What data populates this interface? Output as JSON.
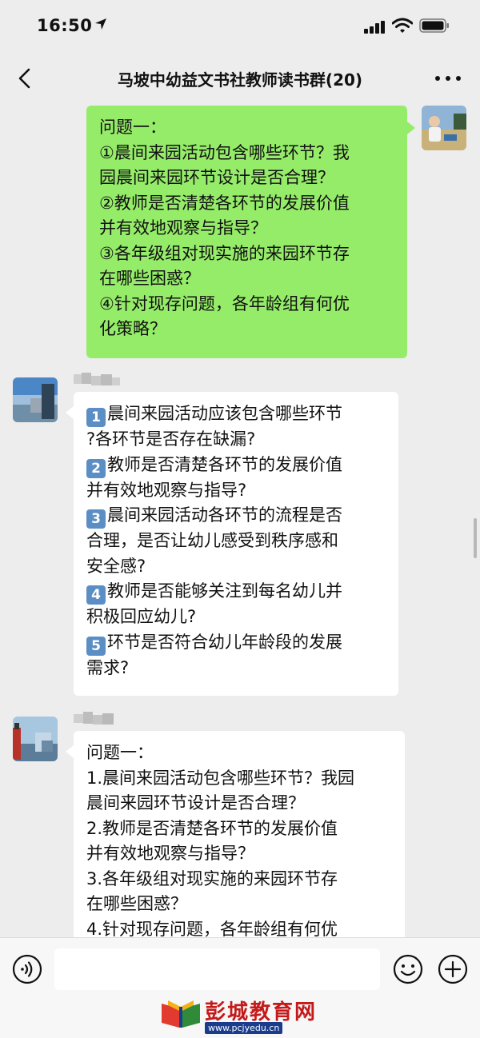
{
  "status_bar": {
    "time": "16:50"
  },
  "nav": {
    "title": "马坡中幼益文书社教师读书群(20)"
  },
  "messages": [
    {
      "side": "right",
      "lines": [
        "问题一：",
        "①晨间来园活动包含哪些环节？我",
        "园晨间来园环节设计是否合理？",
        "②教师是否清楚各环节的发展价值",
        "并有效地观察与指导？",
        "③各年级组对现实施的来园环节存",
        "在哪些困惑？",
        "④针对现存问题，各年龄组有何优",
        "化策略？"
      ]
    },
    {
      "side": "left",
      "nick": "",
      "lines": [
        {
          "n": "1",
          "t": "晨间来园活动应该包含哪些环节"
        },
        {
          "n": "",
          "t": "?各环节是否存在缺漏?"
        },
        {
          "n": "2",
          "t": "教师是否清楚各环节的发展价值"
        },
        {
          "n": "",
          "t": "并有效地观察与指导?"
        },
        {
          "n": "3",
          "t": "晨间来园活动各环节的流程是否"
        },
        {
          "n": "",
          "t": "合理，是否让幼儿感受到秩序感和"
        },
        {
          "n": "",
          "t": "安全感?"
        },
        {
          "n": "4",
          "t": "教师是否能够关注到每名幼儿并"
        },
        {
          "n": "",
          "t": "积极回应幼儿?"
        },
        {
          "n": "5",
          "t": "环节是否符合幼儿年龄段的发展"
        },
        {
          "n": "",
          "t": "需求?"
        }
      ]
    },
    {
      "side": "left",
      "nick": "",
      "lines": [
        "问题一：",
        "1.晨间来园活动包含哪些环节？我园",
        "晨间来园环节设计是否合理？",
        "2.教师是否清楚各环节的发展价值",
        "并有效地观察与指导？",
        "3.各年级组对现实施的来园环节存",
        "在哪些困惑？",
        "4.针对现存问题，各年龄组有何优"
      ]
    }
  ],
  "watermark": {
    "name": "彭城教育网",
    "url": "www.pcjyedu.cn"
  },
  "colors": {
    "bubble_right": "#95ec69",
    "bubble_left": "#ffffff",
    "background": "#ededed",
    "watermark_red": "#c41a1a"
  },
  "icons": [
    "location-arrow-icon",
    "signal-icon",
    "wifi-icon",
    "battery-icon",
    "back-chevron-icon",
    "more-dots-icon",
    "voice-icon",
    "emoji-icon",
    "plus-icon"
  ]
}
